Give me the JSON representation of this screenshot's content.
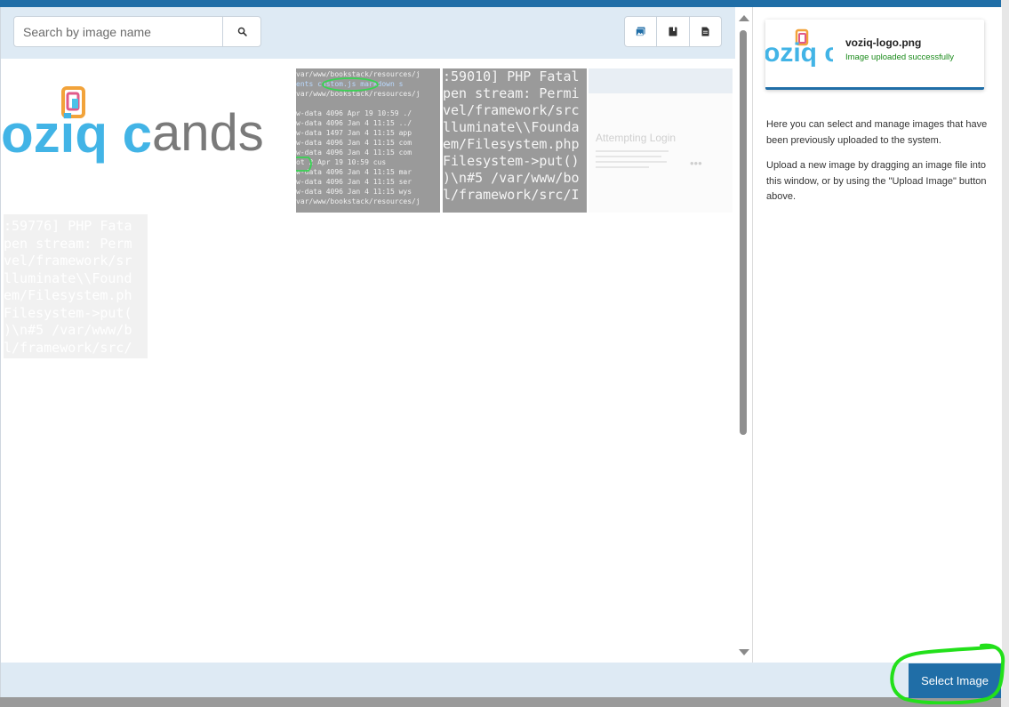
{
  "search": {
    "placeholder": "Search by image name"
  },
  "icons": {
    "search": "search-icon",
    "gallery_type": "image-icon",
    "book_type": "book-icon",
    "page_type": "page-icon"
  },
  "thumbnails": {
    "logo": {
      "name": "voziq-logo",
      "text_left": "oziq c",
      "text_right": "ands"
    },
    "terminal": {
      "lines": [
        "var/www/bookstack/resources/j",
        "ents  custom.js  markdown  s",
        "var/www/bookstack/resources/j",
        "",
        "w-data 4096 Apr 19 10:59 ./",
        "w-data 4096 Jan  4 11:15 ../",
        "w-data 1497 Jan  4 11:15 app",
        "w-data 4096 Jan  4 11:15 com",
        "w-data 4096 Jan  4 11:15 com",
        "ot        2 Apr 19 10:59 cus",
        "w-data 4096 Jan  4 11:15 mar",
        "w-data 4096 Jan  4 11:15 ser",
        "w-data 4096 Jan  4 11:15 wys",
        "var/www/bookstack/resources/j"
      ]
    },
    "php_error_1": {
      "lines": [
        ":59010] PHP Fatal",
        "pen stream: Permi",
        "vel/framework/src",
        "lluminate\\\\Founda",
        "em/Filesystem.php",
        "Filesystem->put()",
        ")\\n#5 /var/www/bo",
        "l/framework/src/I"
      ]
    },
    "login": {
      "title": "Attempting Login",
      "dots": "•••"
    },
    "php_error_2": {
      "lines": [
        ":59776] PHP Fata",
        "pen stream: Perm",
        "vel/framework/sr",
        "lluminate\\\\Found",
        "em/Filesystem.ph",
        "Filesystem->put(",
        ")\\n#5 /var/www/b",
        "l/framework/src/"
      ]
    }
  },
  "upload_card": {
    "filename": "voziq-logo.png",
    "status": "Image uploaded successfully",
    "thumb_text": "oziq c"
  },
  "help": {
    "para1": "Here you can select and manage images that have been previously uploaded to the system.",
    "para2": "Upload a new image by dragging an image file into this window, or by using the \"Upload Image\" button above."
  },
  "footer": {
    "select_label": "Select Image"
  },
  "colors": {
    "primary": "#206ea7",
    "toolbar_bg": "#deeaf4",
    "success": "#1a8a1a",
    "highlight_circle": "#22e01a"
  }
}
